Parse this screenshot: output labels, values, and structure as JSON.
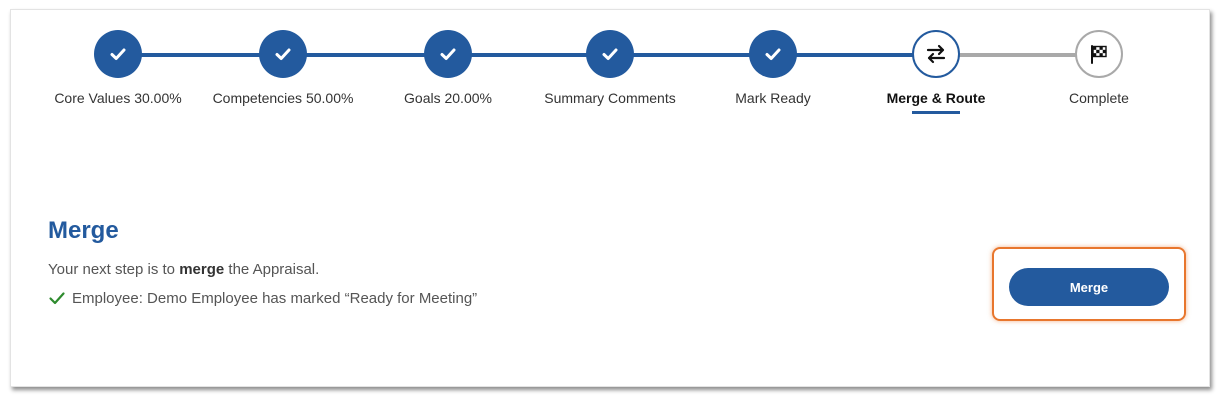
{
  "stepper": {
    "steps": [
      {
        "label": "Core Values 30.00%",
        "state": "done",
        "icon": "check-icon"
      },
      {
        "label": "Competencies 50.00%",
        "state": "done",
        "icon": "check-icon"
      },
      {
        "label": "Goals 20.00%",
        "state": "done",
        "icon": "check-icon"
      },
      {
        "label": "Summary Comments",
        "state": "done",
        "icon": "check-icon"
      },
      {
        "label": "Mark Ready",
        "state": "done",
        "icon": "check-icon"
      },
      {
        "label": "Merge & Route",
        "state": "current",
        "icon": "swap-arrows-icon"
      },
      {
        "label": "Complete",
        "state": "todo",
        "icon": "checkered-flag-icon"
      }
    ]
  },
  "section": {
    "title": "Merge",
    "next_step_prefix": "Your next step is to ",
    "next_step_bold": "merge",
    "next_step_suffix": " the Appraisal.",
    "status_text": "Employee: Demo Employee has marked “Ready for Meeting”"
  },
  "actions": {
    "merge_label": "Merge"
  },
  "colors": {
    "primary": "#235a9e",
    "pending": "#a9a9a9",
    "highlight": "#e8762d",
    "success": "#2e8b2e"
  }
}
